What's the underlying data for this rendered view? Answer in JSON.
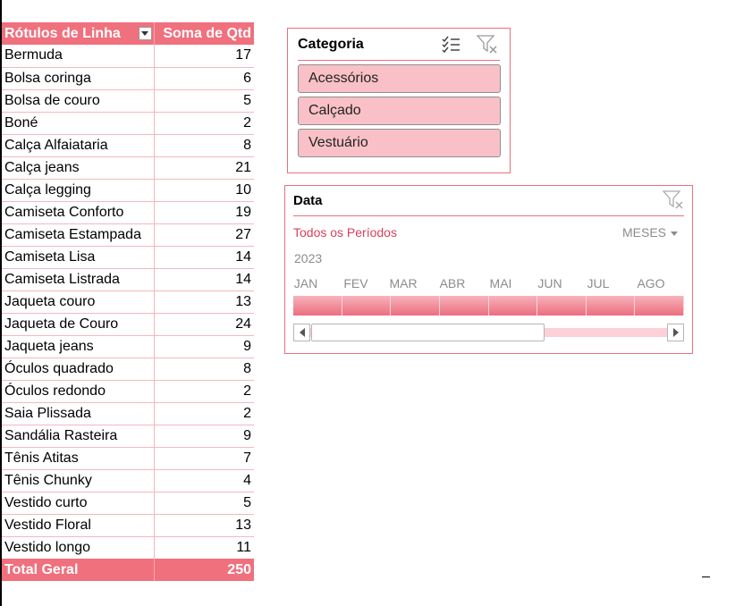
{
  "pivot": {
    "header": {
      "row_label": "Rótulos de Linha",
      "value_label": "Soma de Qtd"
    },
    "rows": [
      {
        "label": "Bermuda",
        "value": "17"
      },
      {
        "label": "Bolsa coringa",
        "value": "6"
      },
      {
        "label": "Bolsa de couro",
        "value": "5"
      },
      {
        "label": "Boné",
        "value": "2"
      },
      {
        "label": "Calça Alfaiataria",
        "value": "8"
      },
      {
        "label": "Calça jeans",
        "value": "21"
      },
      {
        "label": "Calça legging",
        "value": "10"
      },
      {
        "label": "Camiseta Conforto",
        "value": "19"
      },
      {
        "label": "Camiseta Estampada",
        "value": "27"
      },
      {
        "label": "Camiseta Lisa",
        "value": "14"
      },
      {
        "label": "Camiseta Listrada",
        "value": "14"
      },
      {
        "label": "Jaqueta couro",
        "value": "13"
      },
      {
        "label": "Jaqueta de Couro",
        "value": "24"
      },
      {
        "label": "Jaqueta jeans",
        "value": "9"
      },
      {
        "label": "Óculos quadrado",
        "value": "8"
      },
      {
        "label": "Óculos redondo",
        "value": "2"
      },
      {
        "label": "Saia Plissada",
        "value": "2"
      },
      {
        "label": "Sandália Rasteira",
        "value": "9"
      },
      {
        "label": "Tênis Atitas",
        "value": "7"
      },
      {
        "label": "Tênis Chunky",
        "value": "4"
      },
      {
        "label": "Vestido curto",
        "value": "5"
      },
      {
        "label": "Vestido Floral",
        "value": "13"
      },
      {
        "label": "Vestido longo",
        "value": "11"
      }
    ],
    "total": {
      "label": "Total Geral",
      "value": "250"
    }
  },
  "category_slicer": {
    "title": "Categoria",
    "items": [
      "Acessórios",
      "Calçado",
      "Vestuário"
    ],
    "icons": [
      "multi-select-icon",
      "clear-filter-icon"
    ]
  },
  "timeline": {
    "title": "Data",
    "period_label": "Todos os Períodos",
    "level_label": "MESES",
    "year": "2023",
    "months": [
      "JAN",
      "FEV",
      "MAR",
      "ABR",
      "MAI",
      "JUN",
      "JUL",
      "AGO"
    ]
  },
  "colors": {
    "accent": "#f0707e",
    "item_fill": "#f9c1c7",
    "period_text": "#d9405a",
    "muted_text": "#8c8c8c"
  }
}
